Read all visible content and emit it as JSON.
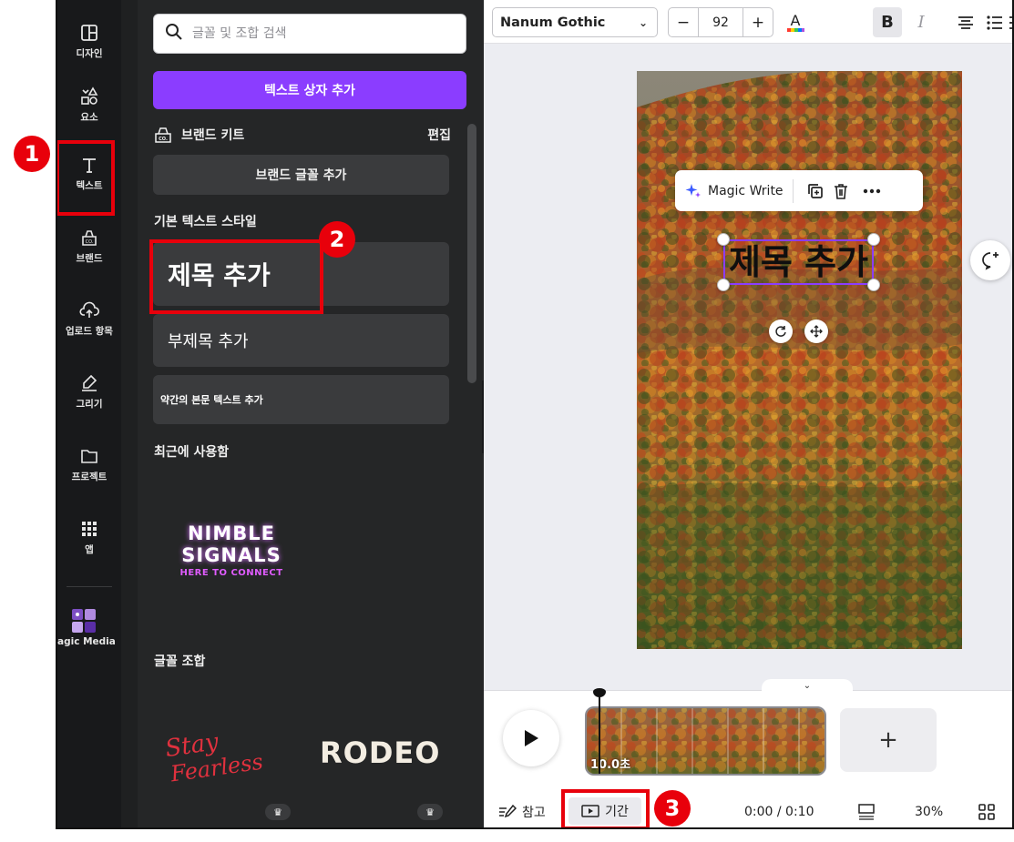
{
  "rail": {
    "items": [
      {
        "label": "디자인",
        "icon": "layout-icon"
      },
      {
        "label": "요소",
        "icon": "shapes-icon"
      },
      {
        "label": "텍스트",
        "icon": "text-icon"
      },
      {
        "label": "브랜드",
        "icon": "brand-icon"
      },
      {
        "label": "업로드 항목",
        "icon": "upload-icon"
      },
      {
        "label": "그리기",
        "icon": "draw-icon"
      },
      {
        "label": "프로젝트",
        "icon": "folder-icon"
      },
      {
        "label": "앱",
        "icon": "apps-icon"
      },
      {
        "label": "agic Media",
        "icon": "magic-media-icon"
      }
    ]
  },
  "panel": {
    "search_placeholder": "글꼴 및 조합 검색",
    "add_textbox_label": "텍스트 상자 추가",
    "brand_kit_label": "브랜드 키트",
    "brand_kit_edit": "편집",
    "brand_font_button": "브랜드 글꼴 추가",
    "default_styles_title": "기본 텍스트 스타일",
    "heading_label": "제목 추가",
    "subheading_label": "부제목 추가",
    "body_label": "약간의 본문 텍스트 추가",
    "recent_title": "최근에 사용함",
    "recent_font_line1": "NIMBLE",
    "recent_font_line2": "SIGNALS",
    "recent_font_tagline": "HERE TO CONNECT",
    "combos_title": "글꼴 조합",
    "combo1_line1": "Stay",
    "combo1_line2": "Fearless",
    "combo2": "RODEO"
  },
  "toolbar": {
    "font_name": "Nanum Gothic",
    "font_size": "92",
    "minus": "−",
    "plus": "+",
    "bold": "B",
    "italic": "I"
  },
  "canvas": {
    "title_text": "제목 추가",
    "magic_write_label": "Magic Write"
  },
  "timeline": {
    "clip_duration": "10.0초",
    "notes_label": "참고",
    "duration_label": "기간",
    "time_display": "0:00 / 0:10",
    "zoom": "30%",
    "add_page": "+"
  },
  "annotations": {
    "badge1": "1",
    "badge2": "2",
    "badge3": "3",
    "color": "#e8000b"
  },
  "colors": {
    "accent": "#8b3dff",
    "rail_bg": "#18191b",
    "panel_bg": "#252627"
  }
}
